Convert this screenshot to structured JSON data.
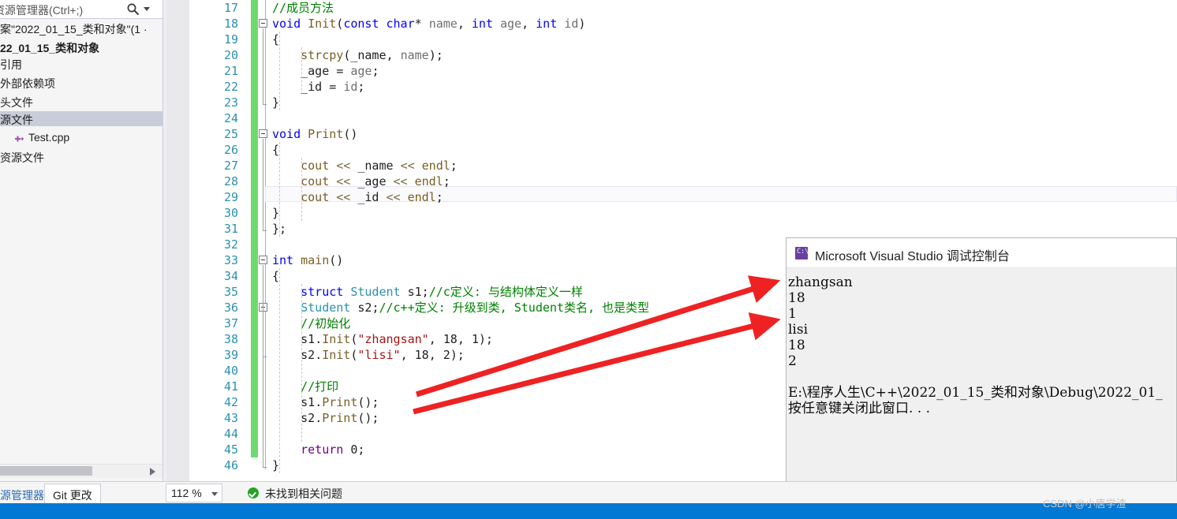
{
  "solution_explorer": {
    "search_placeholder": "资源管理器(Ctrl+;)",
    "search_icon": "search-icon",
    "dropdown_icon": "chevron-down-icon",
    "tree": [
      {
        "label": "案\"2022_01_15_类和对象\"(1 ·",
        "indent": 0,
        "bold": false,
        "selected": false,
        "icon": ""
      },
      {
        "label": "22_01_15_类和对象",
        "indent": 0,
        "bold": true,
        "selected": false,
        "icon": ""
      },
      {
        "label": "引用",
        "indent": 0,
        "bold": false,
        "selected": false,
        "icon": ""
      },
      {
        "label": "外部依赖项",
        "indent": 0,
        "bold": false,
        "selected": false,
        "icon": ""
      },
      {
        "label": "头文件",
        "indent": 0,
        "bold": false,
        "selected": false,
        "icon": ""
      },
      {
        "label": "源文件",
        "indent": 0,
        "bold": false,
        "selected": true,
        "icon": ""
      },
      {
        "label": "Test.cpp",
        "indent": 1,
        "bold": false,
        "selected": false,
        "icon": "cpp-file-icon"
      },
      {
        "label": "资源文件",
        "indent": 0,
        "bold": false,
        "selected": false,
        "icon": ""
      }
    ],
    "hscroll_arrow_icon": "arrow-right-icon"
  },
  "editor": {
    "first_line_number": 17,
    "last_line_number": 46,
    "current_line": 29,
    "lines": [
      {
        "n": 17,
        "html": "<span class='cmt'>//成员方法</span>"
      },
      {
        "n": 18,
        "html": "<span class='kw'>void</span> <span class='fn'>Init</span>(<span class='kw'>const</span> <span class='kw'>char</span>* <span class='gray'>name</span>, <span class='kw'>int</span> <span class='gray'>age</span>, <span class='kw'>int</span> <span class='gray'>id</span>)"
      },
      {
        "n": 19,
        "html": "{"
      },
      {
        "n": 20,
        "html": "    <span class='fn'>strcpy</span>(<span class='id'>_name</span>, <span class='gray'>name</span>);"
      },
      {
        "n": 21,
        "html": "    <span class='id'>_age</span> = <span class='gray'>age</span>;"
      },
      {
        "n": 22,
        "html": "    <span class='id'>_id</span> = <span class='gray'>id</span>;"
      },
      {
        "n": 23,
        "html": "}"
      },
      {
        "n": 24,
        "html": ""
      },
      {
        "n": 25,
        "html": "<span class='kw'>void</span> <span class='fn'>Print</span>()"
      },
      {
        "n": 26,
        "html": "{"
      },
      {
        "n": 27,
        "html": "    <span class='fn'>cout</span> <span class='op'>&lt;&lt;</span> <span class='id'>_name</span> <span class='op'>&lt;&lt;</span> <span class='fn'>endl</span>;"
      },
      {
        "n": 28,
        "html": "    <span class='fn'>cout</span> <span class='op'>&lt;&lt;</span> <span class='id'>_age</span> <span class='op'>&lt;&lt;</span> <span class='fn'>endl</span>;"
      },
      {
        "n": 29,
        "html": "    <span class='fn'>cout</span> <span class='op'>&lt;&lt;</span> <span class='id'>_id</span> <span class='op'>&lt;&lt;</span> <span class='fn'>endl</span>;"
      },
      {
        "n": 30,
        "html": "}"
      },
      {
        "n": 31,
        "html": "};"
      },
      {
        "n": 32,
        "html": ""
      },
      {
        "n": 33,
        "html": "<span class='kw'>int</span> <span class='fn'>main</span>()"
      },
      {
        "n": 34,
        "html": "{"
      },
      {
        "n": 35,
        "html": "    <span class='kw'>struct</span> <span class='typ'>Student</span> <span class='id'>s1</span>;<span class='cmt'>//c定义: 与结构体定义一样</span>"
      },
      {
        "n": 36,
        "html": "    <span class='typ'>Student</span> <span class='id'>s2</span>;<span class='cmt'>//c++定义: 升级到类, Student类名, 也是类型</span>"
      },
      {
        "n": 37,
        "html": "    <span class='cmt'>//初始化</span>"
      },
      {
        "n": 38,
        "html": "    <span class='id'>s1</span>.<span class='fn'>Init</span>(<span class='str'>\"zhangsan\"</span>, <span class='num'>18</span>, <span class='num'>1</span>);"
      },
      {
        "n": 39,
        "html": "    <span class='id'>s2</span>.<span class='fn'>Init</span>(<span class='str'>\"lisi\"</span>, <span class='num'>18</span>, <span class='num'>2</span>);"
      },
      {
        "n": 40,
        "html": ""
      },
      {
        "n": 41,
        "html": "    <span class='cmt'>//打印</span>"
      },
      {
        "n": 42,
        "html": "    <span class='id'>s1</span>.<span class='fn'>Print</span>();"
      },
      {
        "n": 43,
        "html": "    <span class='id'>s2</span>.<span class='fn'>Print</span>();"
      },
      {
        "n": 44,
        "html": ""
      },
      {
        "n": 45,
        "html": "    <span class='purple'>return</span> <span class='num'>0</span>;"
      },
      {
        "n": 46,
        "html": "}"
      }
    ],
    "fold_markers": [
      18,
      25,
      33,
      36
    ],
    "annotation_arrow_color": "#ee2222",
    "change_bar_color": "#6fd96f"
  },
  "console": {
    "icon": "console-window-icon",
    "icon_text": "C:\\",
    "title": "Microsoft Visual Studio 调试控制台",
    "output": [
      "zhangsan",
      "18",
      "1",
      "lisi",
      "18",
      "2",
      "",
      "E:\\程序人生\\C++\\2022_01_15_类和对象\\Debug\\2022_01_",
      "按任意键关闭此窗口. . ."
    ]
  },
  "status_bar": {
    "tab_solution_explorer": "源管理器",
    "tab_git_changes": "Git 更改",
    "zoom_level": "112 %",
    "zoom_dropdown_icon": "chevron-down-icon",
    "problem_icon": "check-circle-icon",
    "problem_text": "未找到相关问题"
  },
  "watermark": "CSDN @小唐学渣"
}
